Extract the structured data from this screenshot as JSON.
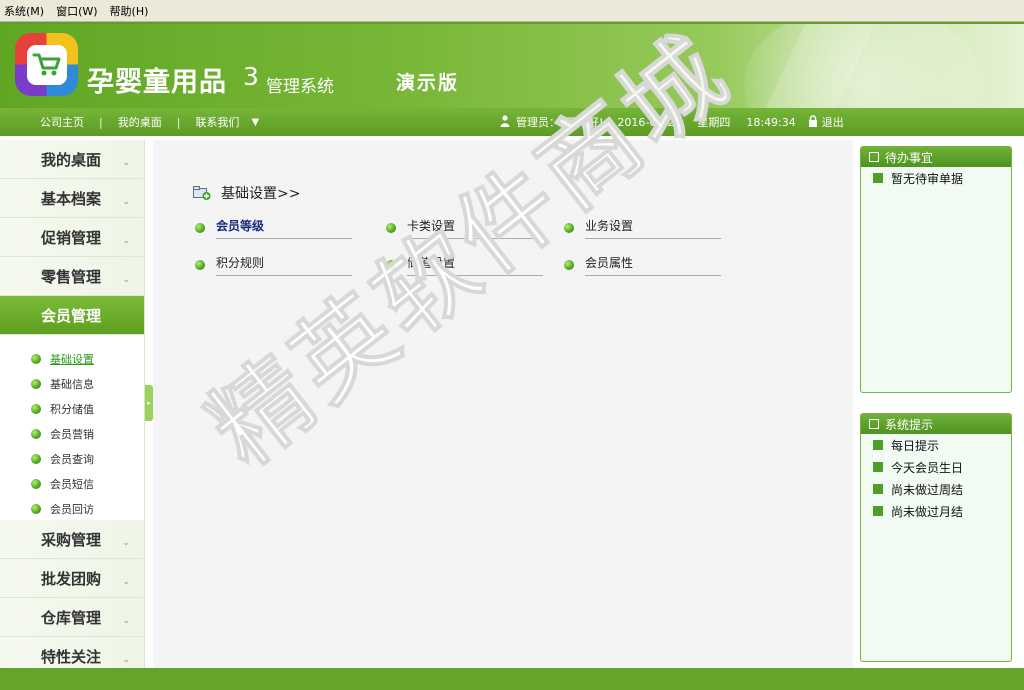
{
  "menubar": {
    "items": [
      "系统(M)",
      "窗口(W)",
      "帮助(H)"
    ]
  },
  "banner": {
    "brand": "孕婴童用品",
    "brand_num": "3",
    "brand_sub": "管理系统",
    "edition": "演示版",
    "logo_icon": "shopping-cart-icon"
  },
  "nav": {
    "links": [
      "公司主页",
      "我的桌面",
      "联系我们"
    ],
    "separator": "|",
    "user_label": "管理员：",
    "greeting": "下午好!",
    "date": "2016-01-28",
    "weekday": "星期四",
    "time": "18:49:34",
    "logout": "退出"
  },
  "sidebar": {
    "groups_top": [
      "我的桌面",
      "基本档案",
      "促销管理",
      "零售管理"
    ],
    "active_group": "会员管理",
    "sub_items": [
      "基础设置",
      "基础信息",
      "积分储值",
      "会员营销",
      "会员查询",
      "会员短信",
      "会员回访"
    ],
    "groups_bottom": [
      "采购管理",
      "批发团购",
      "仓库管理",
      "特性关注"
    ]
  },
  "main": {
    "section_title": "基础设置>>",
    "items": [
      "会员等级",
      "卡类设置",
      "业务设置",
      "积分规则",
      "储值设置",
      "会员属性"
    ]
  },
  "watermark": "精英软件商城",
  "panels": {
    "todo": {
      "title": "待办事宜",
      "rows": [
        "暂无待审单据"
      ]
    },
    "tips": {
      "title": "系统提示",
      "rows": [
        "每日提示",
        "今天会员生日",
        "尚未做过周结",
        "尚未做过月结"
      ]
    }
  },
  "colors": {
    "brand_green": "#5fa722",
    "active_link": "#2e9b15",
    "bold_item": "#1a2a82"
  }
}
